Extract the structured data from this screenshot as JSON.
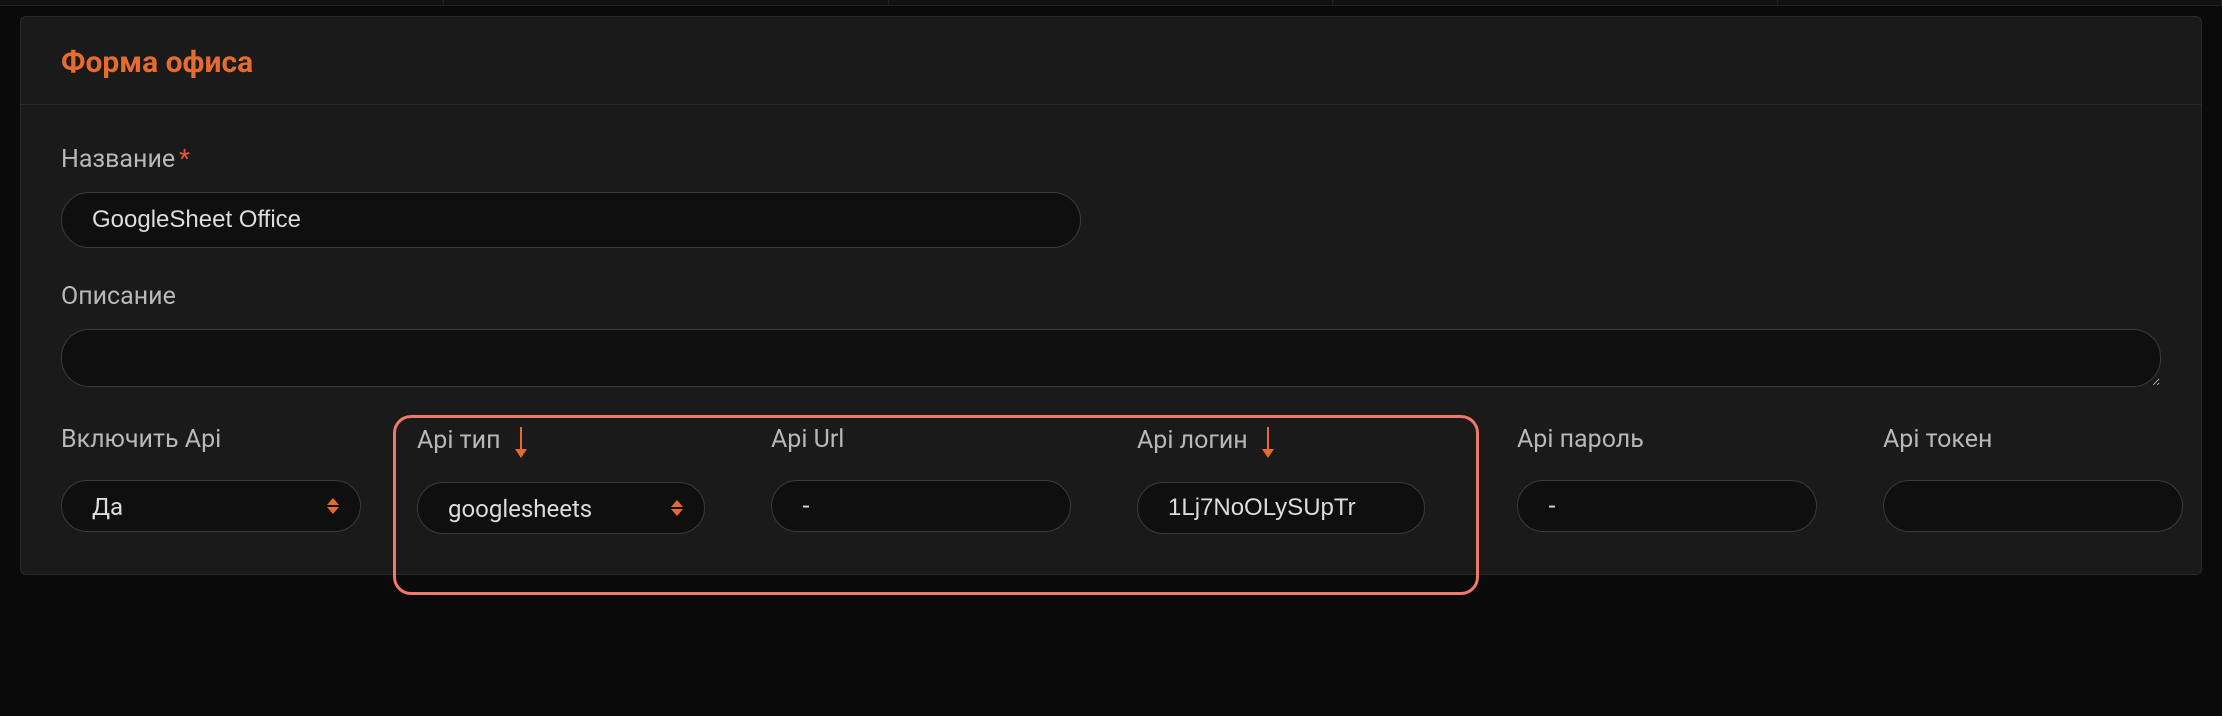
{
  "form": {
    "title": "Форма офиса",
    "name_label": "Название",
    "name_value": "GoogleSheet Office",
    "description_label": "Описание",
    "description_value": "",
    "fields": {
      "enable_api": {
        "label": "Включить Api",
        "value": "Да"
      },
      "api_type": {
        "label": "Api тип",
        "value": "googlesheets"
      },
      "api_url": {
        "label": "Api Url",
        "value": "-"
      },
      "api_login": {
        "label": "Api логин",
        "value": "1Lj7NoOLySUpTr"
      },
      "api_pass": {
        "label": "Api пароль",
        "value": "-"
      },
      "api_token": {
        "label": "Api токен",
        "value": ""
      }
    }
  }
}
